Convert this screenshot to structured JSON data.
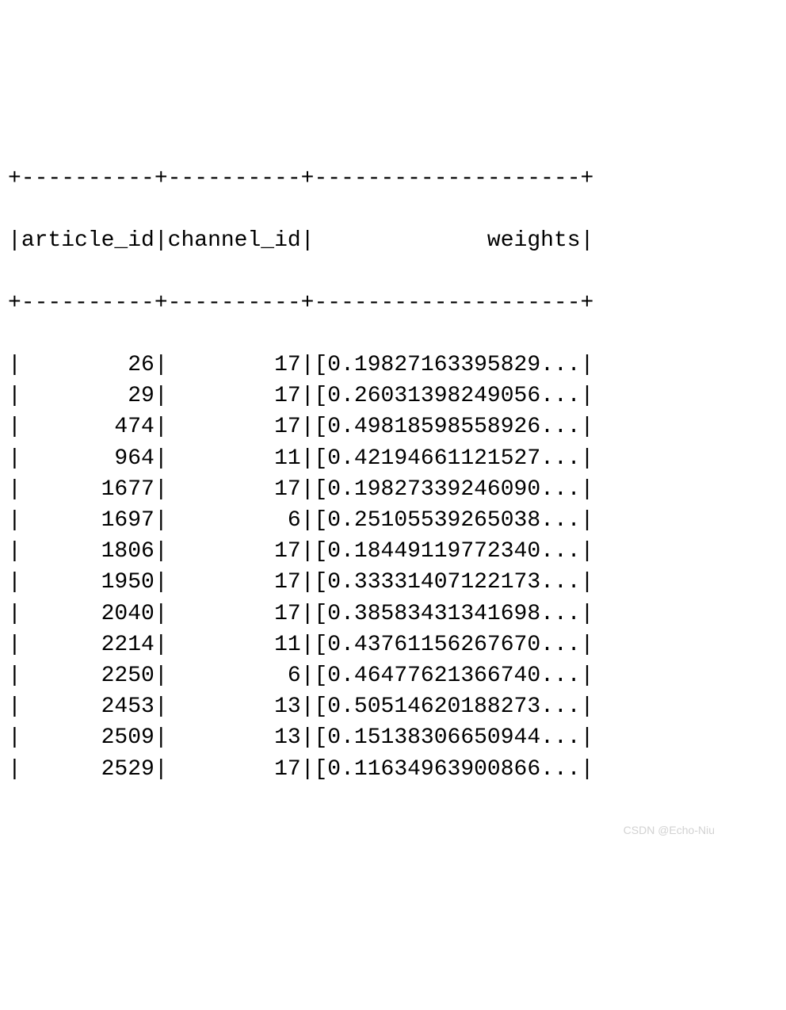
{
  "table": {
    "border_top": "+----------+----------+--------------------+",
    "border_mid": "+----------+----------+--------------------+",
    "header": {
      "col1": "article_id",
      "col2": "channel_id",
      "col3": "weights"
    },
    "rows": [
      {
        "article_id": "26",
        "channel_id": "17",
        "weights": "[0.19827163395829..."
      },
      {
        "article_id": "29",
        "channel_id": "17",
        "weights": "[0.26031398249056..."
      },
      {
        "article_id": "474",
        "channel_id": "17",
        "weights": "[0.49818598558926..."
      },
      {
        "article_id": "964",
        "channel_id": "11",
        "weights": "[0.42194661121527..."
      },
      {
        "article_id": "1677",
        "channel_id": "17",
        "weights": "[0.19827339246090..."
      },
      {
        "article_id": "1697",
        "channel_id": "6",
        "weights": "[0.25105539265038..."
      },
      {
        "article_id": "1806",
        "channel_id": "17",
        "weights": "[0.18449119772340..."
      },
      {
        "article_id": "1950",
        "channel_id": "17",
        "weights": "[0.33331407122173..."
      },
      {
        "article_id": "2040",
        "channel_id": "17",
        "weights": "[0.38583431341698..."
      },
      {
        "article_id": "2214",
        "channel_id": "11",
        "weights": "[0.43761156267670..."
      },
      {
        "article_id": "2250",
        "channel_id": "6",
        "weights": "[0.46477621366740..."
      },
      {
        "article_id": "2453",
        "channel_id": "13",
        "weights": "[0.50514620188273..."
      },
      {
        "article_id": "2509",
        "channel_id": "13",
        "weights": "[0.15138306650944..."
      },
      {
        "article_id": "2529",
        "channel_id": "17",
        "weights": "[0.11634963900866..."
      }
    ],
    "col_widths": {
      "c1": 10,
      "c2": 10,
      "c3": 20
    }
  },
  "watermark": "CSDN @Echo-Niu"
}
